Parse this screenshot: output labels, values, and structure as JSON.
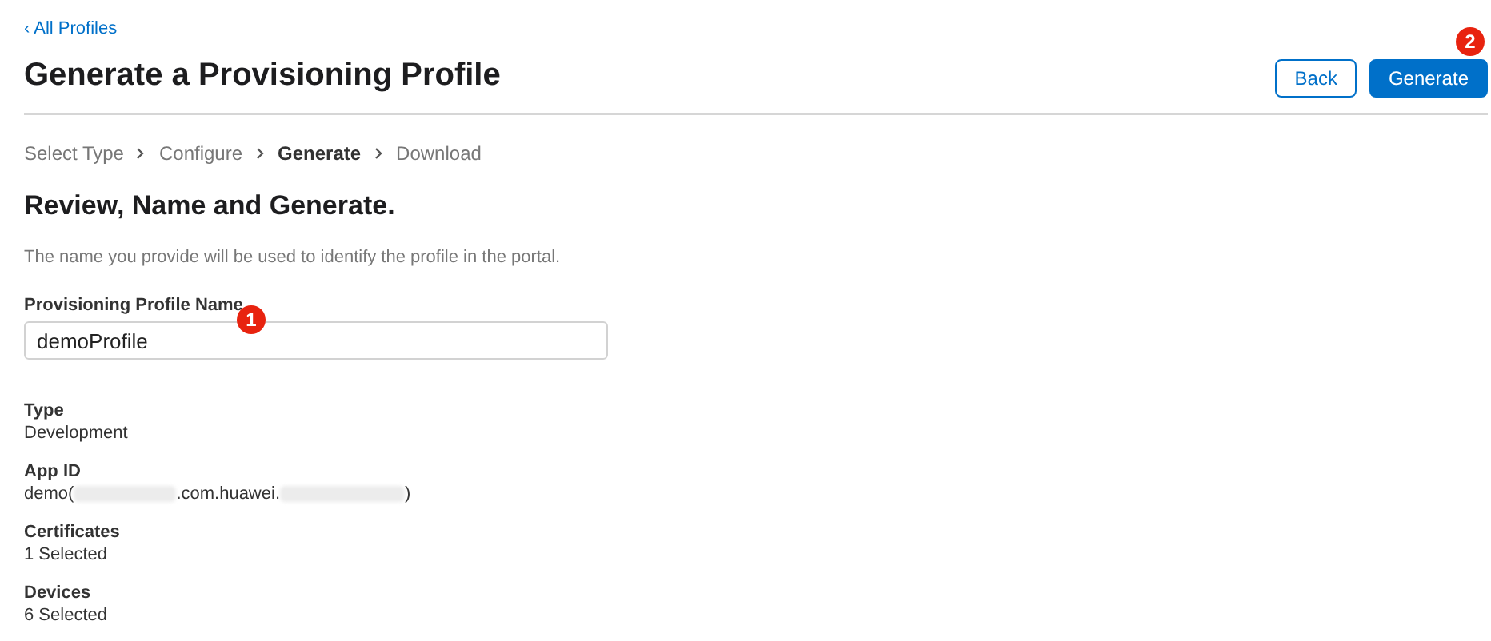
{
  "back_link": "‹ All Profiles",
  "title": "Generate a Provisioning Profile",
  "buttons": [
    {
      "label": "Back",
      "kind": "secondary"
    },
    {
      "label": "Generate",
      "kind": "primary",
      "badge": "2"
    }
  ],
  "steps": [
    {
      "label": "Select Type",
      "selected": false
    },
    {
      "label": "Configure",
      "selected": false
    },
    {
      "label": "Generate",
      "selected": true
    },
    {
      "label": "Download",
      "selected": false
    }
  ],
  "heading": "Review, Name and Generate.",
  "description": "The name you provide will be used to identify the profile in the portal.",
  "name_field": {
    "label": "Provisioning Profile Name",
    "value": "demoProfile",
    "badge": "1"
  },
  "details": [
    {
      "label": "Type",
      "parts": [
        {
          "kind": "text",
          "text": "Development"
        }
      ]
    },
    {
      "label": "App ID",
      "parts": [
        {
          "kind": "text",
          "text": "demo("
        },
        {
          "kind": "redacted"
        },
        {
          "kind": "text",
          "text": ".com.huawei."
        },
        {
          "kind": "redacted"
        },
        {
          "kind": "text",
          "text": ")"
        }
      ]
    },
    {
      "label": "Certificates",
      "parts": [
        {
          "kind": "text",
          "text": "1 Selected"
        }
      ]
    },
    {
      "label": "Devices",
      "parts": [
        {
          "kind": "text",
          "text": "6 Selected"
        }
      ]
    }
  ]
}
